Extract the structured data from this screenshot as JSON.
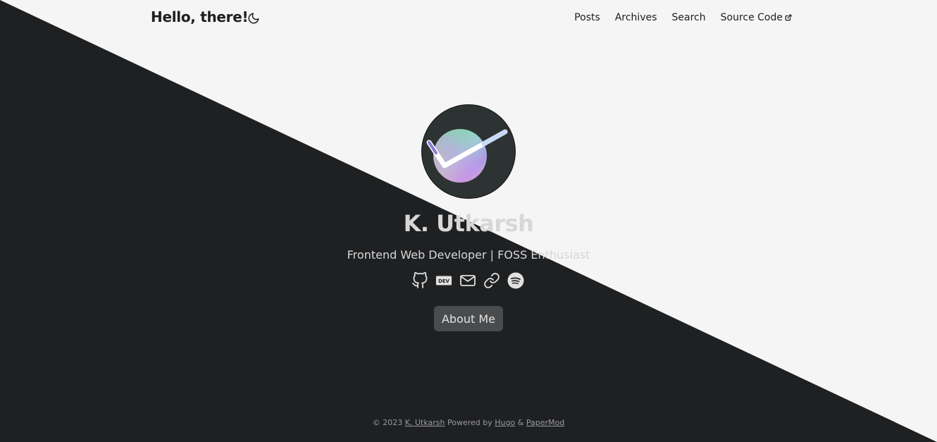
{
  "colors": {
    "light_bg": "#f5f5f5",
    "dark_bg": "#1f2022",
    "button_bg": "#4a4b4d"
  },
  "header": {
    "title": "Hello, there!",
    "theme_toggle_icon": "moon-icon",
    "nav": [
      {
        "label": "Posts"
      },
      {
        "label": "Archives"
      },
      {
        "label": "Search"
      },
      {
        "label": "Source Code",
        "icon": "external-link-icon"
      }
    ]
  },
  "profile": {
    "name": "K. Utkarsh",
    "subtitle": "Frontend Web Developer | FOSS Enthusiast",
    "social_icons": [
      "github-icon",
      "dev-icon",
      "mail-icon",
      "link-icon",
      "spotify-icon"
    ],
    "about_button": "About Me"
  },
  "footer": {
    "copyright": "© 2023",
    "author": "K. Utkarsh",
    "powered_by": "Powered by",
    "hugo": "Hugo",
    "amp": "&",
    "papermod": "PaperMod"
  }
}
